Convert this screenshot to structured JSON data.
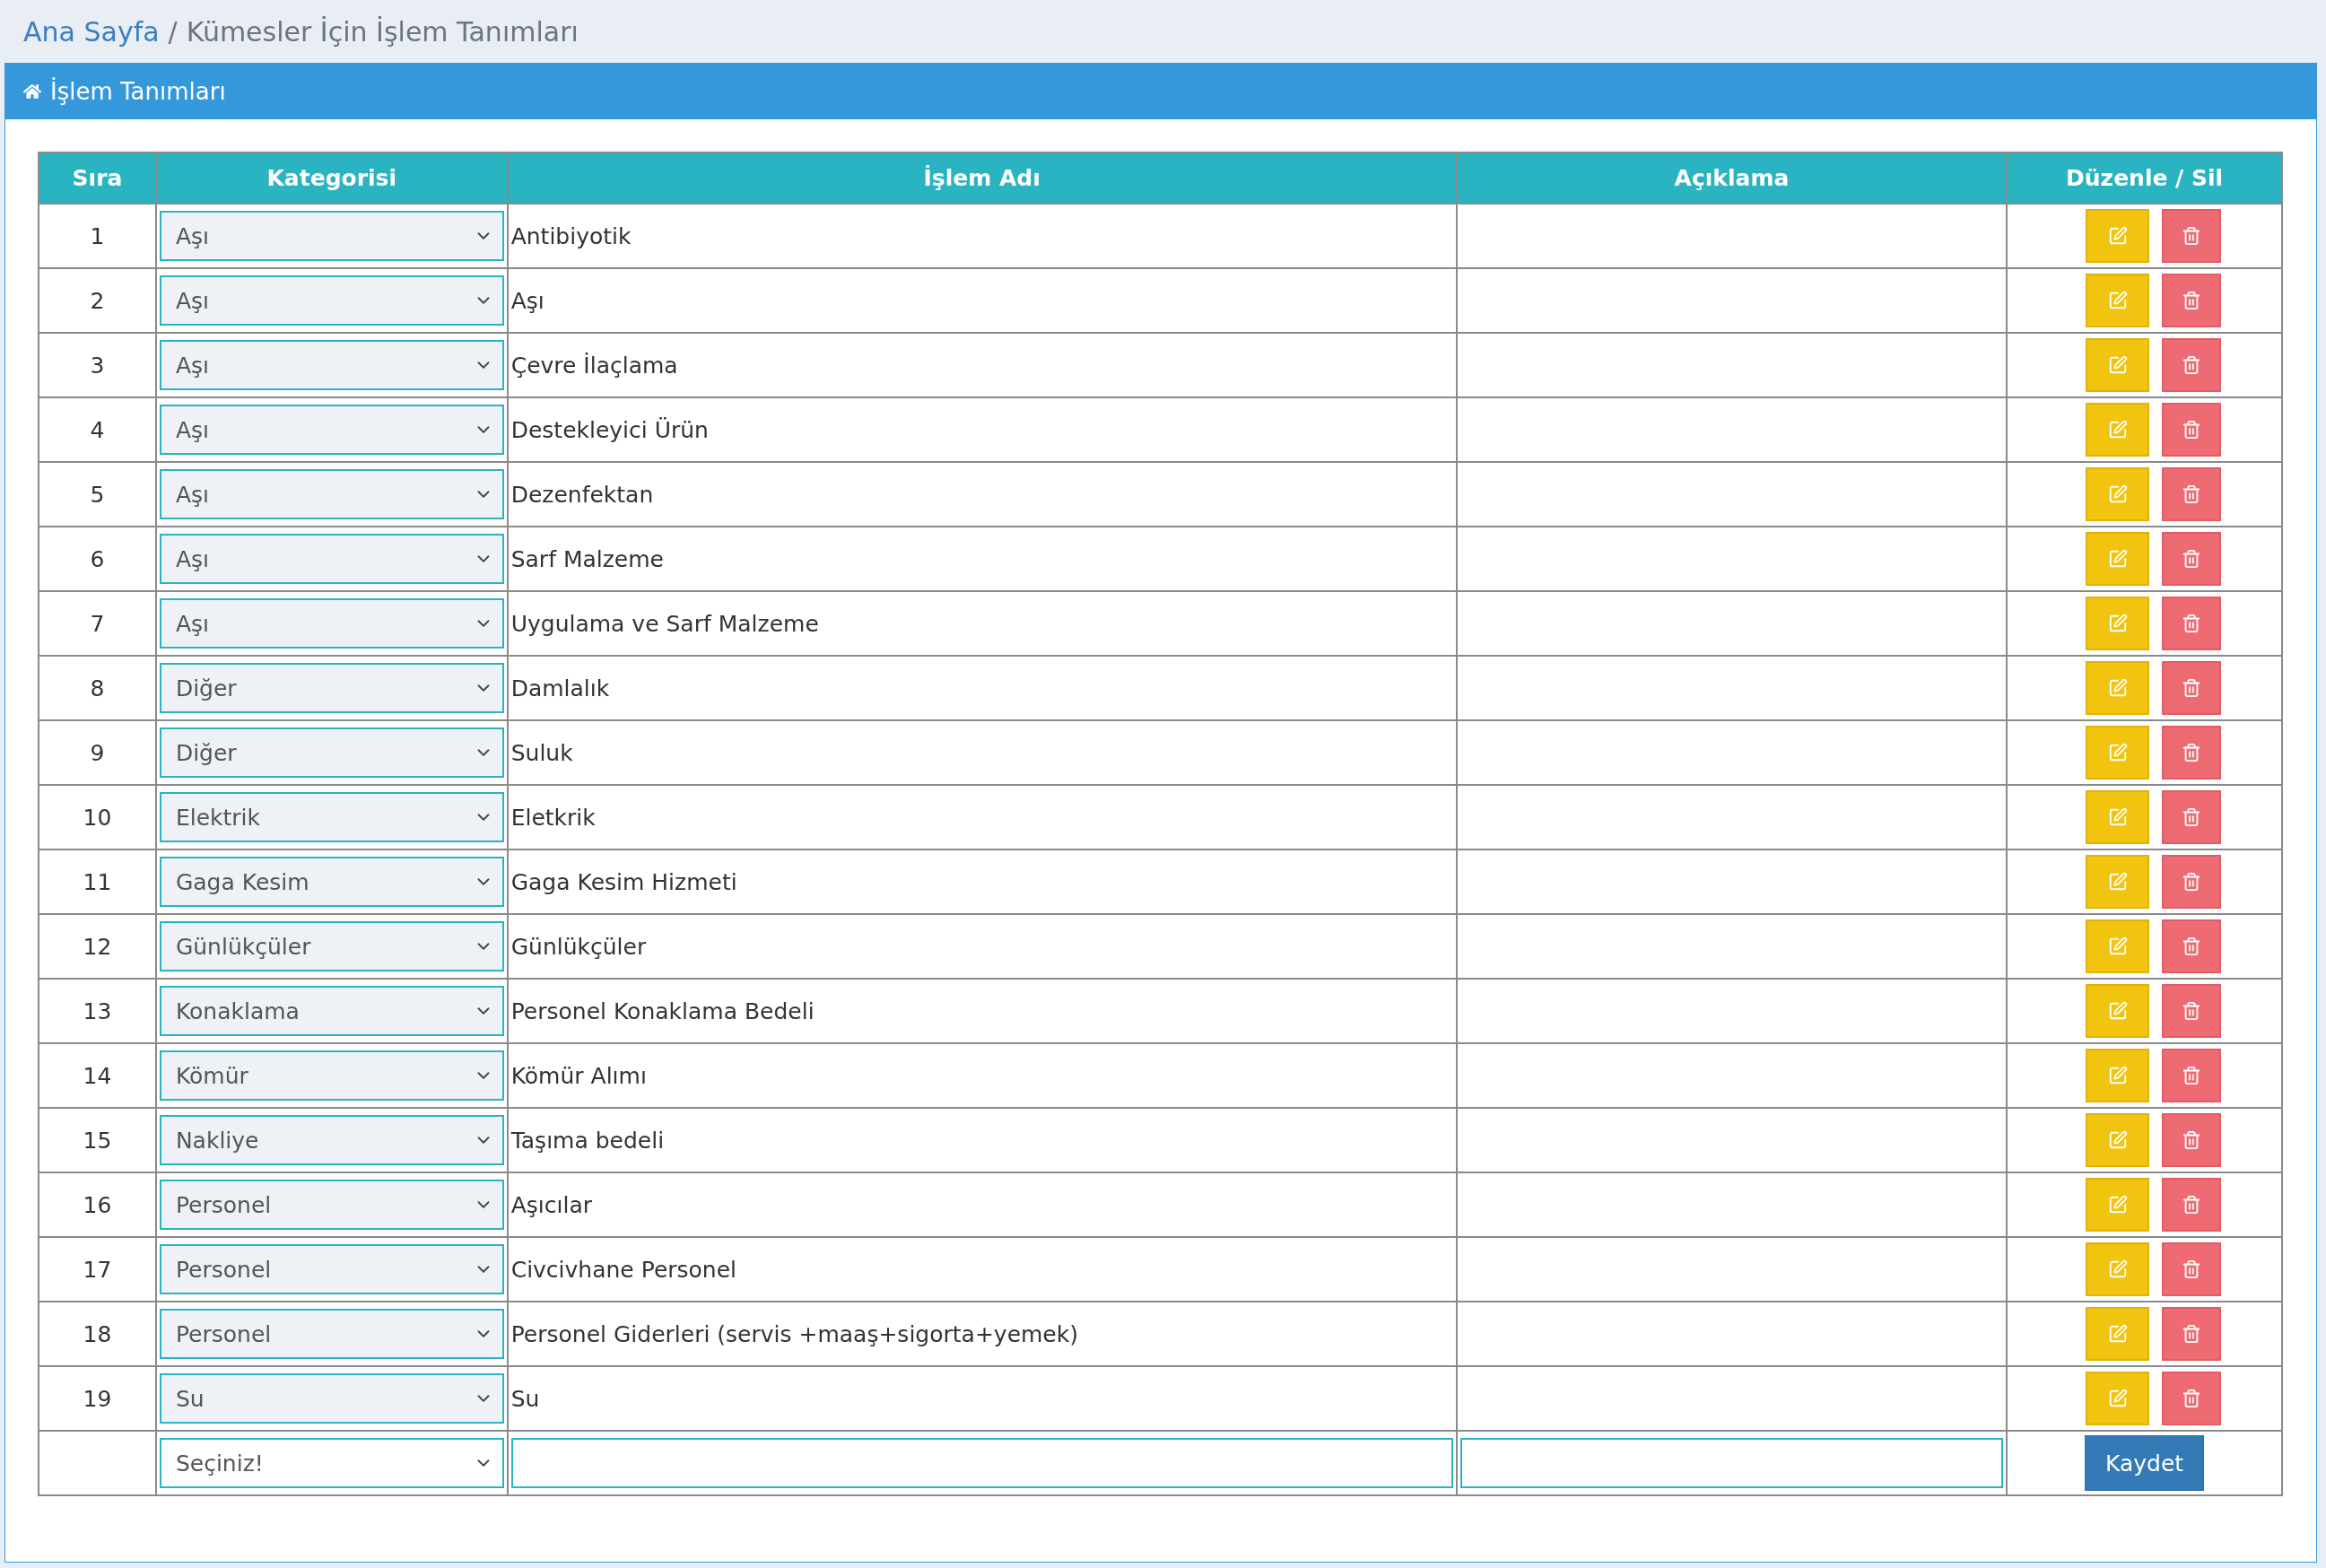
{
  "breadcrumb": {
    "home": "Ana Sayfa",
    "separator": "/",
    "current": "Kümesler İçin İşlem Tanımları"
  },
  "panel": {
    "title": "İşlem Tanımları"
  },
  "table": {
    "columns": [
      "Sıra",
      "Kategorisi",
      "İşlem Adı",
      "Açıklama",
      "Düzenle / Sil"
    ],
    "rows": [
      {
        "no": "1",
        "category": "Aşı",
        "name": "Antibiyotik"
      },
      {
        "no": "2",
        "category": "Aşı",
        "name": "Aşı"
      },
      {
        "no": "3",
        "category": "Aşı",
        "name": "Çevre İlaçlama"
      },
      {
        "no": "4",
        "category": "Aşı",
        "name": "Destekleyici Ürün"
      },
      {
        "no": "5",
        "category": "Aşı",
        "name": "Dezenfektan"
      },
      {
        "no": "6",
        "category": "Aşı",
        "name": "Sarf Malzeme"
      },
      {
        "no": "7",
        "category": "Aşı",
        "name": "Uygulama ve Sarf Malzeme"
      },
      {
        "no": "8",
        "category": "Diğer",
        "name": "Damlalık"
      },
      {
        "no": "9",
        "category": "Diğer",
        "name": "Suluk"
      },
      {
        "no": "10",
        "category": "Elektrik",
        "name": "Eletkrik"
      },
      {
        "no": "11",
        "category": "Gaga Kesim",
        "name": "Gaga Kesim Hizmeti"
      },
      {
        "no": "12",
        "category": "Günlükçüler",
        "name": "Günlükçüler"
      },
      {
        "no": "13",
        "category": "Konaklama",
        "name": "Personel Konaklama Bedeli"
      },
      {
        "no": "14",
        "category": "Kömür",
        "name": "Kömür Alımı"
      },
      {
        "no": "15",
        "category": "Nakliye",
        "name": "Taşıma bedeli"
      },
      {
        "no": "16",
        "category": "Personel",
        "name": "Aşıcılar"
      },
      {
        "no": "17",
        "category": "Personel",
        "name": "Civcivhane Personel"
      },
      {
        "no": "18",
        "category": "Personel",
        "name": "Personel Giderleri (servis +maaş+sigorta+yemek)"
      },
      {
        "no": "19",
        "category": "Su",
        "name": "Su"
      }
    ],
    "new_row": {
      "category": "Seçiniz!",
      "save_button": "Kaydet"
    }
  }
}
